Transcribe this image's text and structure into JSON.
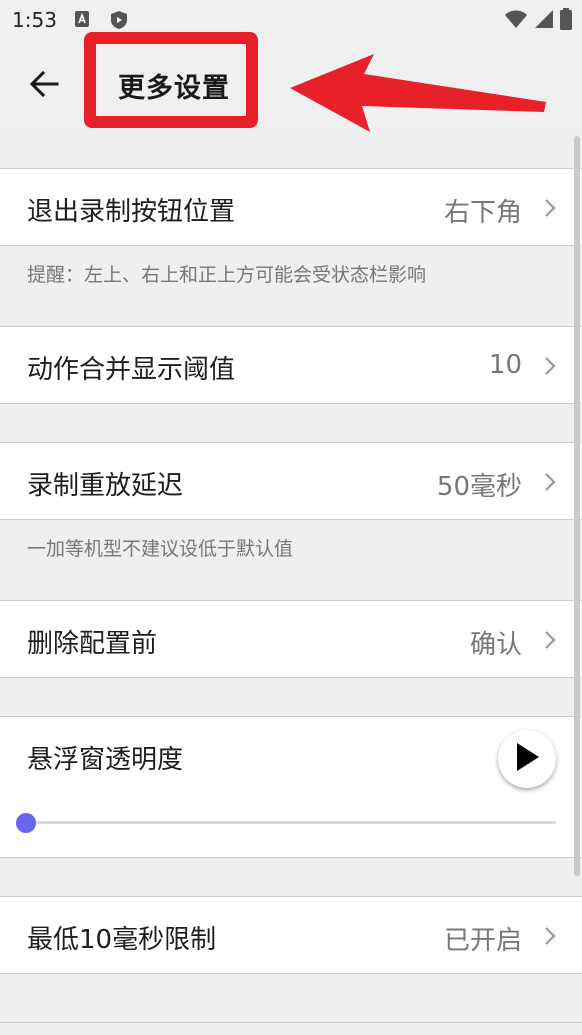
{
  "status_bar": {
    "time": "1:53"
  },
  "app_bar": {
    "title": "更多设置"
  },
  "settings": {
    "exit_button_position": {
      "label": "退出录制按钮位置",
      "value": "右下角"
    },
    "exit_button_hint": "提醒：左上、右上和正上方可能会受状态栏影响",
    "action_merge_threshold": {
      "label": "动作合并显示阈值",
      "value": "10"
    },
    "replay_delay": {
      "label": "录制重放延迟",
      "value": "50毫秒"
    },
    "replay_delay_hint": "一加等机型不建议设低于默认值",
    "delete_config": {
      "label": "删除配置前",
      "value": "确认"
    },
    "float_opacity": {
      "label": "悬浮窗透明度",
      "level": 0
    },
    "min_10ms_limit": {
      "label": "最低10毫秒限制",
      "value": "已开启"
    }
  },
  "colors": {
    "accent": "#6666ee",
    "highlight_red": "#e8202a",
    "background": "#efefef"
  },
  "icons": {
    "back": "arrow-left-icon",
    "chevron": "chevron-right-icon",
    "play": "play-icon"
  }
}
